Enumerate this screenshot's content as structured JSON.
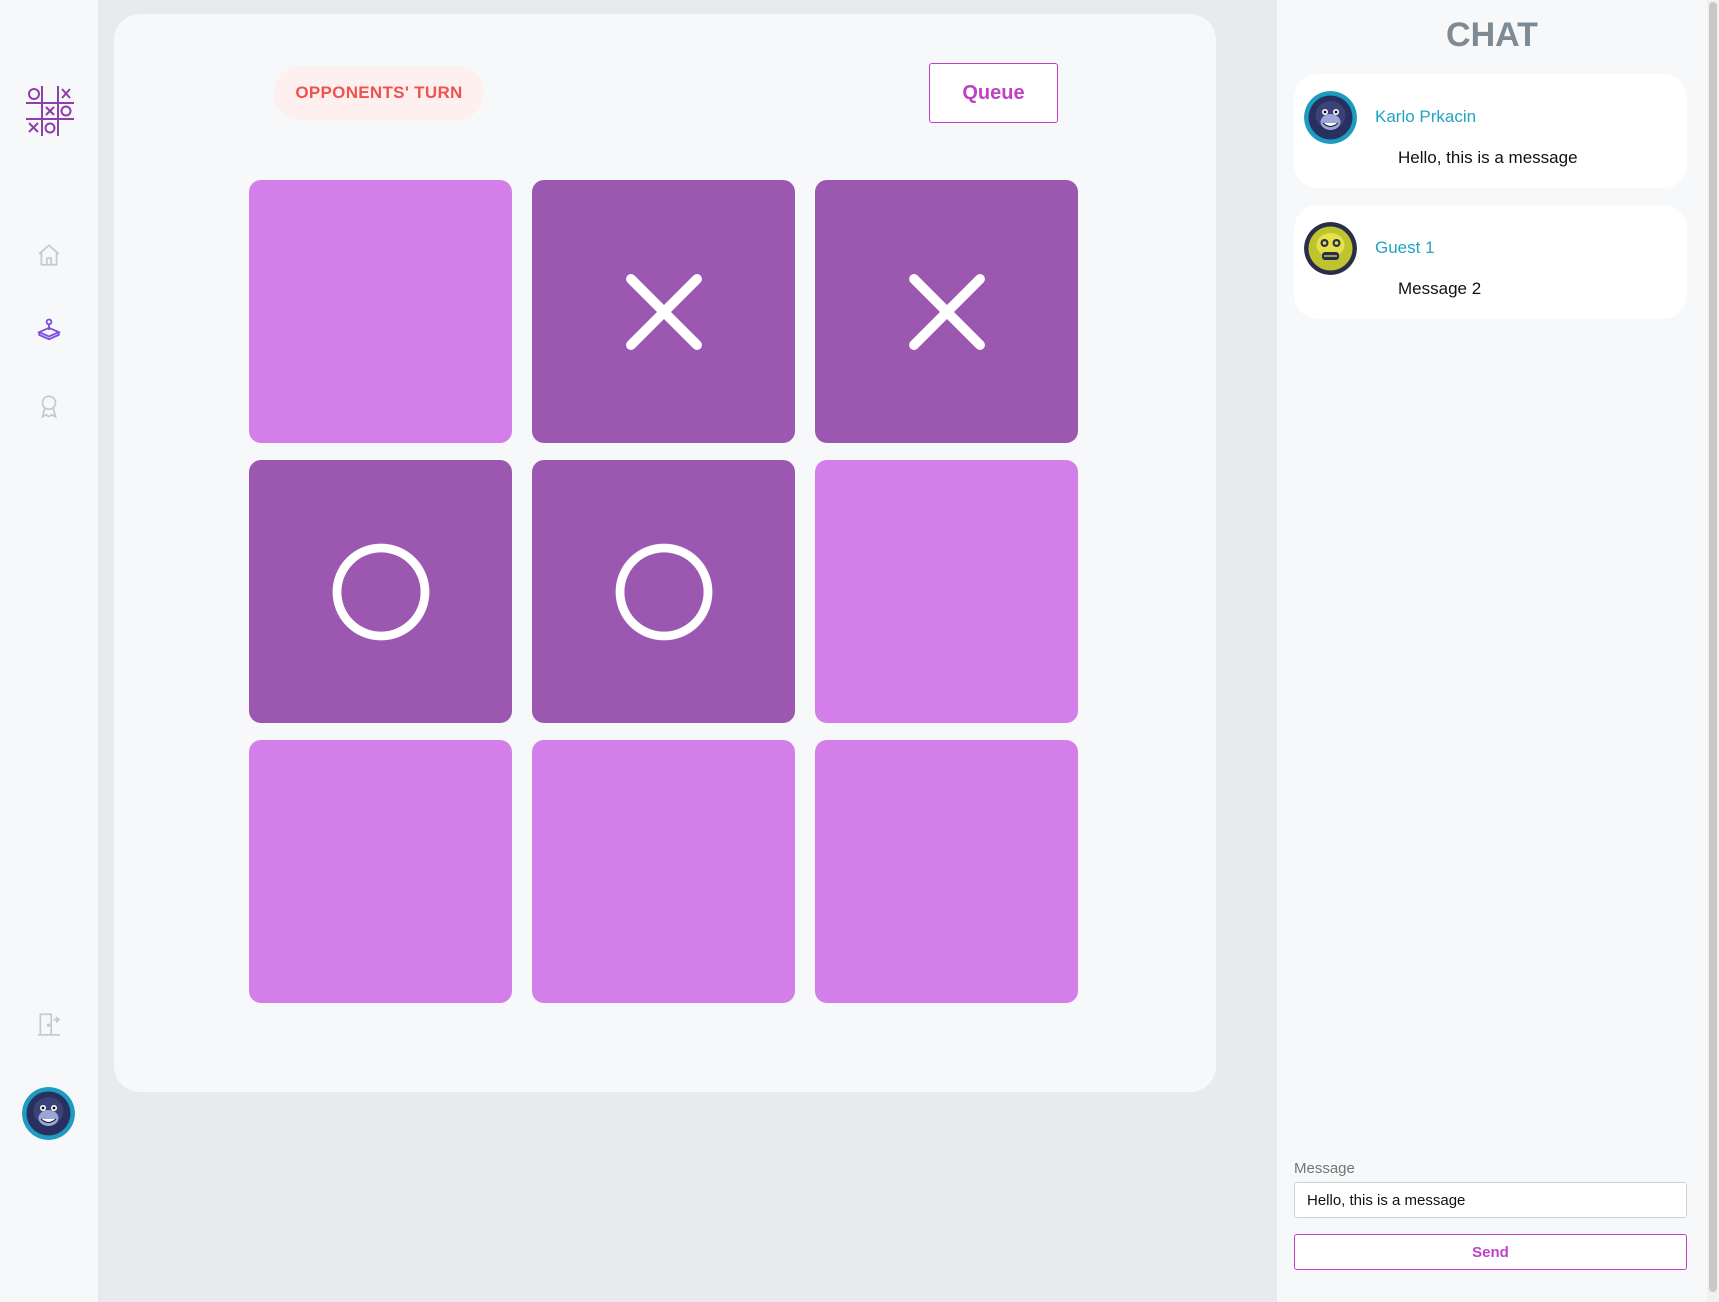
{
  "sidebar": {
    "logo_icon": "tic-tac-toe-logo-icon",
    "nav": [
      {
        "icon": "home-icon",
        "active": false
      },
      {
        "icon": "joystick-icon",
        "active": true
      },
      {
        "icon": "award-icon",
        "active": false
      }
    ],
    "logout_icon": "logout-door-icon",
    "avatar": "user-avatar"
  },
  "game": {
    "turn_label": "OPPONENTS' TURN",
    "queue_label": "Queue",
    "board": [
      [
        "",
        "X",
        "X"
      ],
      [
        "O",
        "O",
        ""
      ],
      [
        "",
        "",
        ""
      ]
    ]
  },
  "chat": {
    "title": "CHAT",
    "messages": [
      {
        "name": "Karlo Prkacin",
        "text": "Hello, this is a message",
        "avatar": "monkey-avatar-blue"
      },
      {
        "name": "Guest 1",
        "text": "Message 2",
        "avatar": "monkey-avatar-yellow"
      }
    ],
    "input_label": "Message",
    "input_value": "Hello, this is a message",
    "send_label": "Send"
  },
  "colors": {
    "accent": "#c040c8",
    "cell_empty": "#d47eea",
    "cell_filled": "#9c57b0",
    "turn_text": "#ef5350",
    "turn_bg": "#fdf0ef",
    "chat_name": "#20a4c4",
    "nav_active": "#7c4ddc",
    "nav_inactive": "#c5cad0"
  }
}
